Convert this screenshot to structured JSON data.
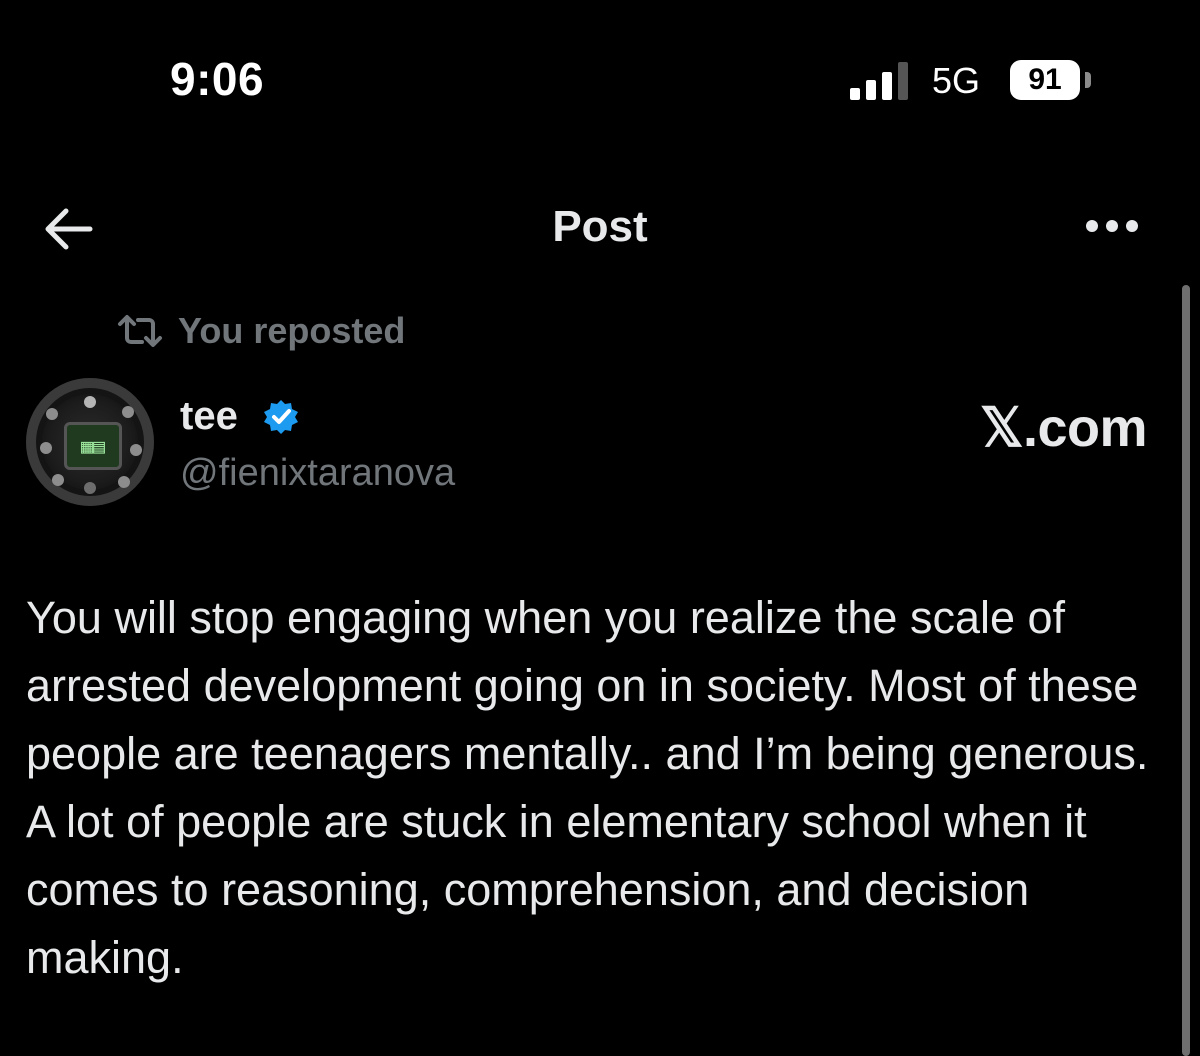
{
  "status_bar": {
    "time": "9:06",
    "network": "5G",
    "battery": "91"
  },
  "header": {
    "title": "Post",
    "back_icon": "arrow-left-icon",
    "more_icon": "more-horizontal-icon"
  },
  "repost": {
    "icon": "repost-icon",
    "text": "You reposted"
  },
  "author": {
    "name": "tee",
    "handle": "@fienixtaranova",
    "verified": true,
    "verified_color": "#1d9bf0"
  },
  "watermark": "𝕏.com",
  "post": {
    "text": "You will stop engaging when you realize the scale of arrested development going on in society. Most of these people are teenagers mentally.. and I’m being generous. A lot of people are stuck in elementary school when it comes to reasoning, comprehension, and decision making."
  },
  "colors": {
    "background": "#000000",
    "primary_text": "#e7e9ea",
    "secondary_text": "#71767b",
    "accent": "#1d9bf0"
  }
}
